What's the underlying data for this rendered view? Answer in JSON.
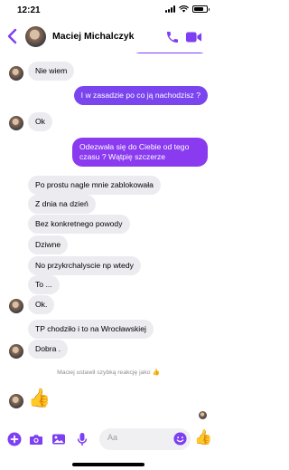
{
  "status_bar": {
    "time": "12:21",
    "battery_level": 0.8
  },
  "header": {
    "contact_name": "Maciej Michalczyk"
  },
  "messages": [
    {
      "side": "in",
      "text": "Nie wiem"
    },
    {
      "side": "out",
      "text": "I w zasadzie po co ją nachodzisz ?"
    },
    {
      "side": "in",
      "text": "Ok"
    },
    {
      "side": "out",
      "text": "Odezwała się do Ciebie od tego czasu ? Wątpię szczerze"
    },
    {
      "side": "in",
      "text": "Po prostu nagle mnie zablokowała"
    },
    {
      "side": "in",
      "text": "Z dnia na dzień"
    },
    {
      "side": "in",
      "text": "Bez konkretnego powody"
    },
    {
      "side": "in",
      "text": "Dziwne"
    },
    {
      "side": "in",
      "text": "No przykrchalyscie np wtedy"
    },
    {
      "side": "in",
      "text": "To ..."
    },
    {
      "side": "in",
      "text": "Ok."
    },
    {
      "side": "in",
      "text": "TP chodziło i to na Wrocławskiej"
    },
    {
      "side": "in",
      "text": "Dobra ."
    }
  ],
  "system_note": "Maciej ustawił szybką reakcję jako 👍",
  "quick_reaction": "👍",
  "composer": {
    "placeholder": "Aa",
    "value": ""
  },
  "colors": {
    "accent": "#7d3ff2",
    "incoming_bubble": "#ececf0",
    "outgoing_bubble": "#8a3bf0"
  },
  "icons": [
    "back-chevron-icon",
    "phone-icon",
    "video-camera-icon",
    "plus-icon",
    "camera-icon",
    "image-icon",
    "microphone-icon",
    "emoji-icon",
    "thumbs-up-icon"
  ]
}
